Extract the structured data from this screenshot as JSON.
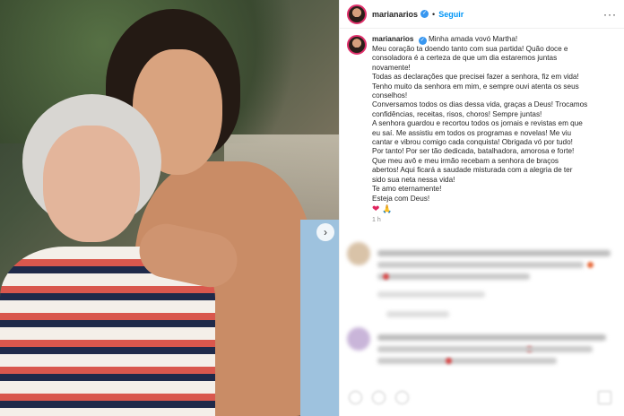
{
  "post": {
    "username": "marianarios",
    "follow_label": "Seguir",
    "separator": "•",
    "more_label": "···",
    "verified_glyph": "✓"
  },
  "caption": {
    "username": "marianarios",
    "lines": [
      "Minha amada vovó Martha!",
      "Meu coração ta doendo tanto com sua partida! Quão doce e",
      "consoladora é a certeza de que um dia estaremos juntas",
      "novamente!",
      "Todas as declarações que precisei fazer a senhora, fiz em vida!",
      "Tenho muito da senhora em mim, e sempre ouvi atenta os seus",
      "conselhos!",
      "Conversamos todos os dias dessa vida, graças a Deus! Trocamos",
      "confidências, receitas, risos, choros! Sempre juntas!",
      "A senhora guardou e recortou todos os jornais e revistas em que",
      "eu saí. Me assistiu em todos os programas e novelas! Me viu",
      "cantar e vibrou comigo cada conquista! Obrigada vó por tudo!",
      "Por tanto! Por ser tão dedicada, batalhadora, amorosa e forte!",
      "Que meu avô e meu irmão recebam a senhora de braços",
      "abertos! Aqui ficará a saudade misturada com a alegria de ter",
      "sido sua neta nessa vida!",
      "Te amo eternamente!",
      "Esteja com Deus!"
    ],
    "emoji_heart": "❤",
    "emoji_pray": "🙏",
    "time": "1 h"
  },
  "photo": {
    "next_arrow": "›"
  },
  "icons": {
    "verified": "verified-badge-icon",
    "more": "more-options-icon",
    "next": "chevron-right-icon",
    "like": "heart-icon",
    "comment": "comment-icon",
    "share": "share-icon",
    "save": "bookmark-icon"
  },
  "colors": {
    "accent_blue": "#0095f6",
    "verified_blue": "#3897f0",
    "heart_red": "#e0245e",
    "text": "#262626",
    "muted": "#8e8e8e"
  }
}
